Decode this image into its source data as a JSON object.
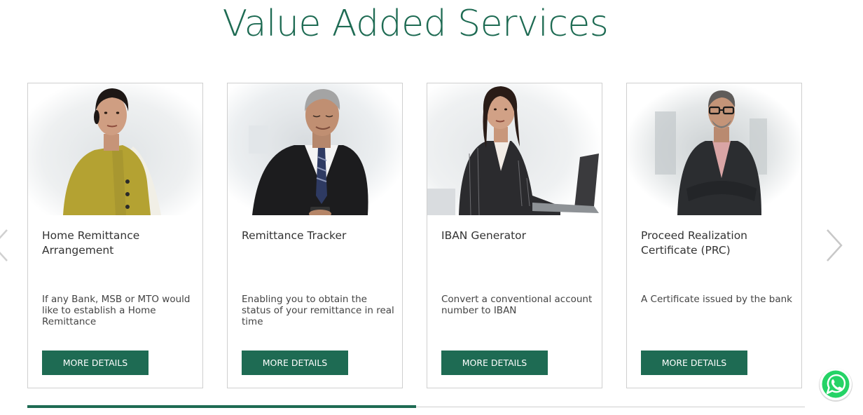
{
  "section": {
    "title": "Value Added Services"
  },
  "cards": [
    {
      "title": "Home Remittance Arrangement",
      "description": "If any Bank, MSB or MTO would like to establish a Home Remittance",
      "button_label": "MORE DETAILS"
    },
    {
      "title": "Remittance Tracker",
      "description": "Enabling you to obtain the status of your remittance in real time",
      "button_label": "MORE DETAILS"
    },
    {
      "title": "IBAN Generator",
      "description": "Convert a conventional account number to IBAN",
      "button_label": "MORE DETAILS"
    },
    {
      "title": "Proceed Realization Certificate (PRC)",
      "description": "A Certificate issued by the bank",
      "button_label": "MORE DETAILS"
    }
  ],
  "carousel": {
    "progress_fraction": 0.5,
    "prev_icon": "chevron-left-icon",
    "next_icon": "chevron-right-icon"
  },
  "colors": {
    "brand_green": "#1e6b53",
    "whatsapp_green": "#25d366"
  },
  "whatsapp": {
    "icon": "whatsapp-icon"
  }
}
